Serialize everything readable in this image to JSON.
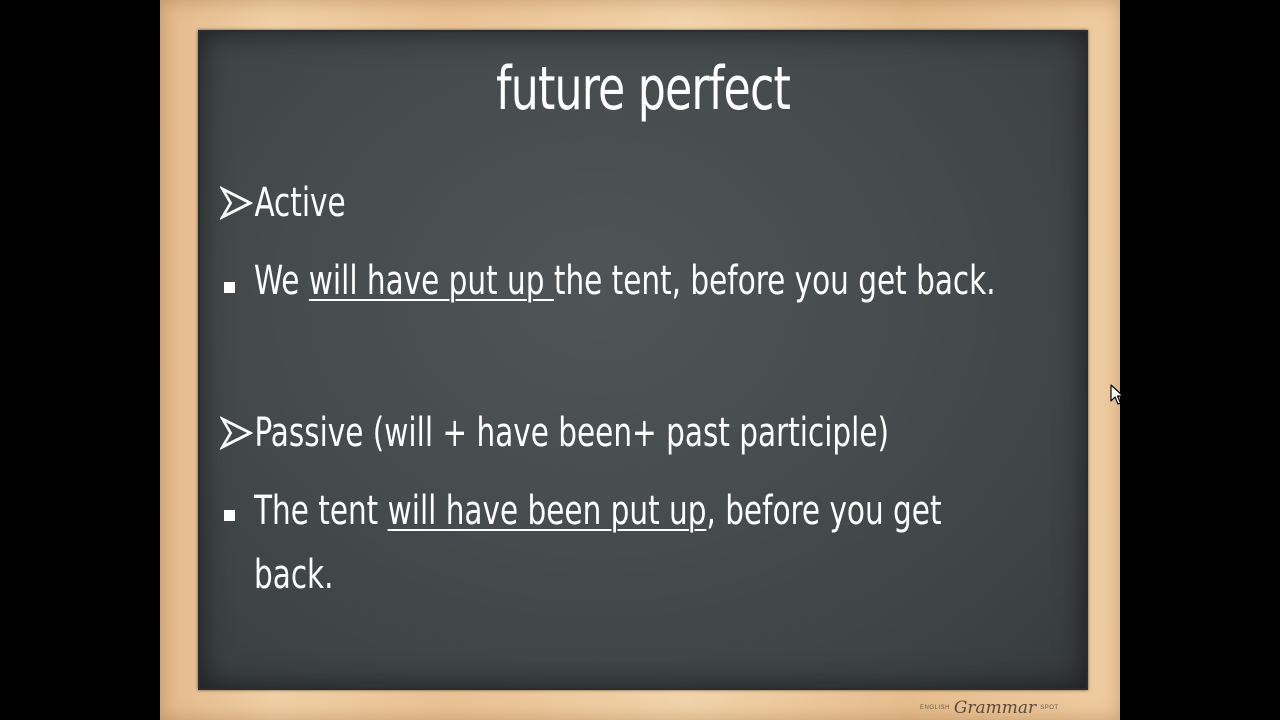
{
  "slide": {
    "title": "future perfect",
    "active_heading": "Active",
    "active_example": {
      "prefix": "We ",
      "underlined": "will have put up ",
      "suffix": "the tent, before you get back."
    },
    "passive_heading": "Passive (will + have been+ past participle)",
    "passive_example": {
      "prefix": "The tent ",
      "underlined": "will have been put up",
      "suffix": ", before you get",
      "continuation": "back."
    },
    "footer": {
      "left": "ENGLISH",
      "brand": "Grammar",
      "right": "SPOT"
    }
  },
  "icons": {
    "heading_bullet": "arrow-bullet-icon",
    "item_bullet": "square-bullet-icon",
    "cursor": "mouse-cursor-icon"
  },
  "colors": {
    "board": "#464c4d",
    "frame": "#ecc69a",
    "text": "#ffffff",
    "background": "#000000"
  }
}
